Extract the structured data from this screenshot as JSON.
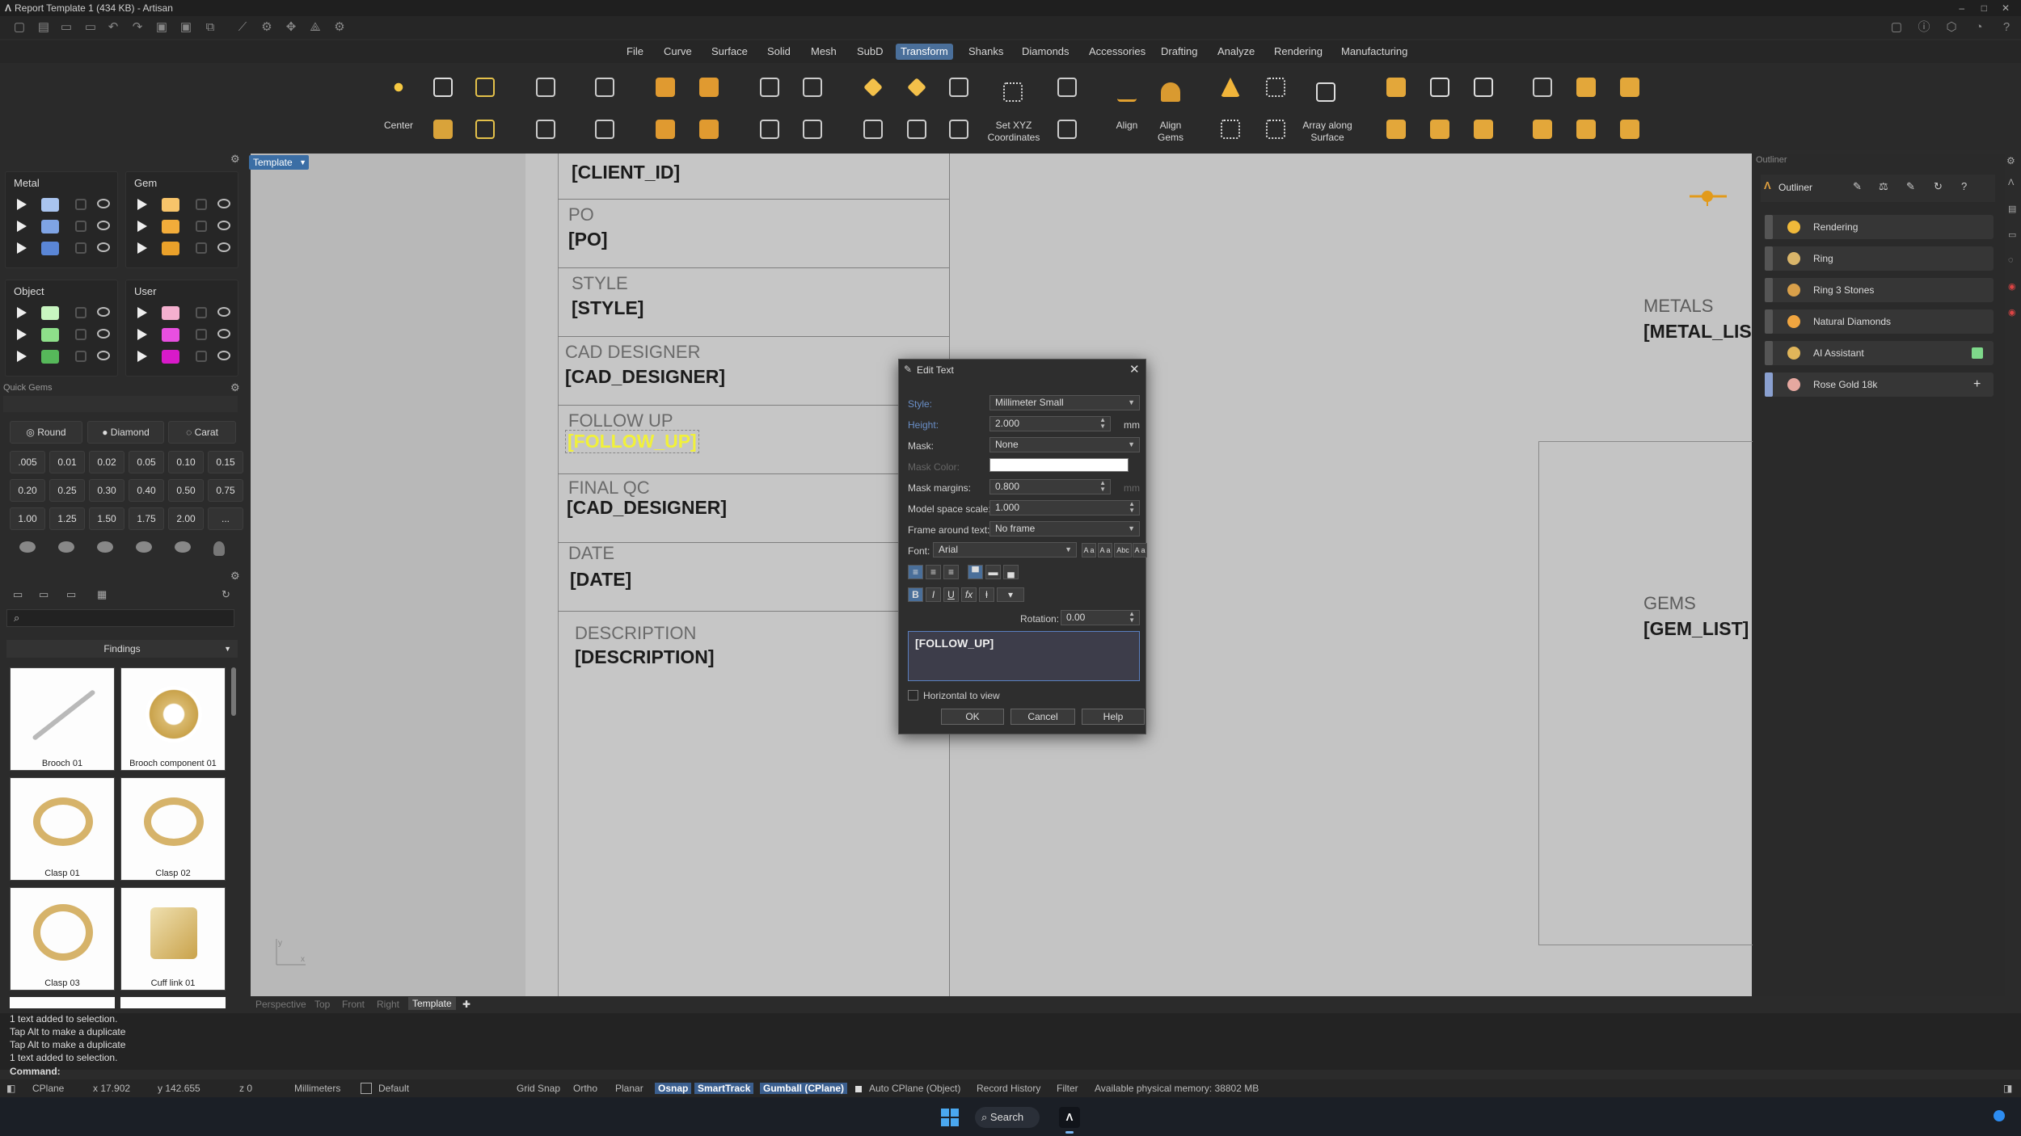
{
  "window": {
    "title": "Report Template 1 (434 KB) - Artisan"
  },
  "menu": [
    "File",
    "Curve",
    "Surface",
    "Solid",
    "Mesh",
    "SubD",
    "Transform",
    "Shanks",
    "Diamonds",
    "Accessories",
    "Drafting",
    "Analyze",
    "Rendering",
    "Manufacturing"
  ],
  "menu_active": "Transform",
  "toolbar": {
    "center_label": "Center",
    "set_xyz_label": "Set XYZ Coordinates",
    "align_label": "Align",
    "align_gems_label": "Align Gems",
    "array_surface_label": "Array along Surface"
  },
  "layers": {
    "metal_title": "Metal",
    "gem_title": "Gem",
    "object_title": "Object",
    "user_title": "User",
    "metal_colors": [
      "#a9c4ef",
      "#7fa4e4",
      "#5a86d6"
    ],
    "gem_colors": [
      "#f7c46a",
      "#f2ac3a",
      "#eaa12a"
    ],
    "object_colors": [
      "#c8f5c0",
      "#8ee08a",
      "#56b85a"
    ],
    "user_colors": [
      "#f4b0cf",
      "#e84fe0",
      "#d81ac9"
    ]
  },
  "quick_gems": {
    "title": "Quick Gems",
    "round_label": "Round",
    "diamond_label": "Diamond",
    "carat_label": "Carat",
    "sizes": [
      ".005",
      "0.01",
      "0.02",
      "0.05",
      "0.10",
      "0.15",
      "0.20",
      "0.25",
      "0.30",
      "0.40",
      "0.50",
      "0.75",
      "1.00",
      "1.25",
      "1.50",
      "1.75",
      "2.00",
      "..."
    ]
  },
  "findings": {
    "dropdown": "Findings",
    "items": [
      "Brooch 01",
      "Brooch component 01",
      "Clasp 01",
      "Clasp 02",
      "Clasp 03",
      "Cuff link 01"
    ]
  },
  "viewport": {
    "tab_label": "Template",
    "cells": [
      {
        "label": "",
        "value": "[CLIENT_ID]"
      },
      {
        "label": "PO",
        "value": "[PO]"
      },
      {
        "label": "STYLE",
        "value": "[STYLE]"
      },
      {
        "label": "CAD DESIGNER",
        "value": "[CAD_DESIGNER]"
      },
      {
        "label": "FOLLOW UP",
        "value": "[FOLLOW_UP]"
      },
      {
        "label": "FINAL QC",
        "value": "[CAD_DESIGNER]"
      },
      {
        "label": "DATE",
        "value": "[DATE]"
      },
      {
        "label": "DESCRIPTION",
        "value": "[DESCRIPTION]"
      }
    ],
    "metals_label": "METALS",
    "metals_value": "[METAL_LIS",
    "gems_label": "GEMS",
    "gems_value": "[GEM_LIST]",
    "tabs": [
      "Perspective",
      "Top",
      "Front",
      "Right",
      "Template"
    ],
    "active_tab": "Template"
  },
  "dialog": {
    "title": "Edit Text",
    "style_label": "Style:",
    "style_value": "Millimeter Small",
    "height_label": "Height:",
    "height_value": "2.000",
    "height_unit": "mm",
    "mask_label": "Mask:",
    "mask_value": "None",
    "mask_color_label": "Mask Color:",
    "mask_margins_label": "Mask margins:",
    "mask_margins_value": "0.800",
    "mask_margins_unit": "mm",
    "model_scale_label": "Model space scale:",
    "model_scale_value": "1.000",
    "frame_label": "Frame around text:",
    "frame_value": "No frame",
    "font_label": "Font:",
    "font_value": "Arial",
    "case_buttons": [
      "A a",
      "A a",
      "Abc",
      "A a"
    ],
    "rotation_label": "Rotation:",
    "rotation_value": "0.00",
    "text_value": "[FOLLOW_UP]",
    "horizontal_label": "Horizontal to view",
    "ok_label": "OK",
    "cancel_label": "Cancel",
    "help_label": "Help"
  },
  "outliner": {
    "panel_title": "Outliner",
    "header_title": "Outliner",
    "items": [
      {
        "label": "Rendering",
        "color": "#f0b93a"
      },
      {
        "label": "Ring",
        "color": "#d9b56a"
      },
      {
        "label": "Ring 3 Stones",
        "color": "#d9a04a"
      },
      {
        "label": "Natural Diamonds",
        "color": "#f0a540"
      },
      {
        "label": "AI Assistant",
        "color": "#e0b55a"
      },
      {
        "label": "Rose Gold 18k",
        "color": "#e6a8a0"
      }
    ]
  },
  "command": {
    "history": [
      "1 text added to selection.",
      "Tap Alt to make a duplicate",
      "Tap Alt to make a duplicate",
      "1 text added to selection."
    ],
    "prompt": "Command:"
  },
  "status": {
    "cplane": "CPlane",
    "x": "x 17.902",
    "y": "y 142.655",
    "z": "z 0",
    "units": "Millimeters",
    "layer": "Default",
    "grid_snap": "Grid Snap",
    "ortho": "Ortho",
    "planar": "Planar",
    "osnap": "Osnap",
    "smarttrack": "SmartTrack",
    "gumball": "Gumball (CPlane)",
    "auto_cplane": "Auto CPlane (Object)",
    "record_history": "Record History",
    "filter": "Filter",
    "memory": "Available physical memory: 38802 MB"
  },
  "taskbar": {
    "search_label": "Search"
  }
}
